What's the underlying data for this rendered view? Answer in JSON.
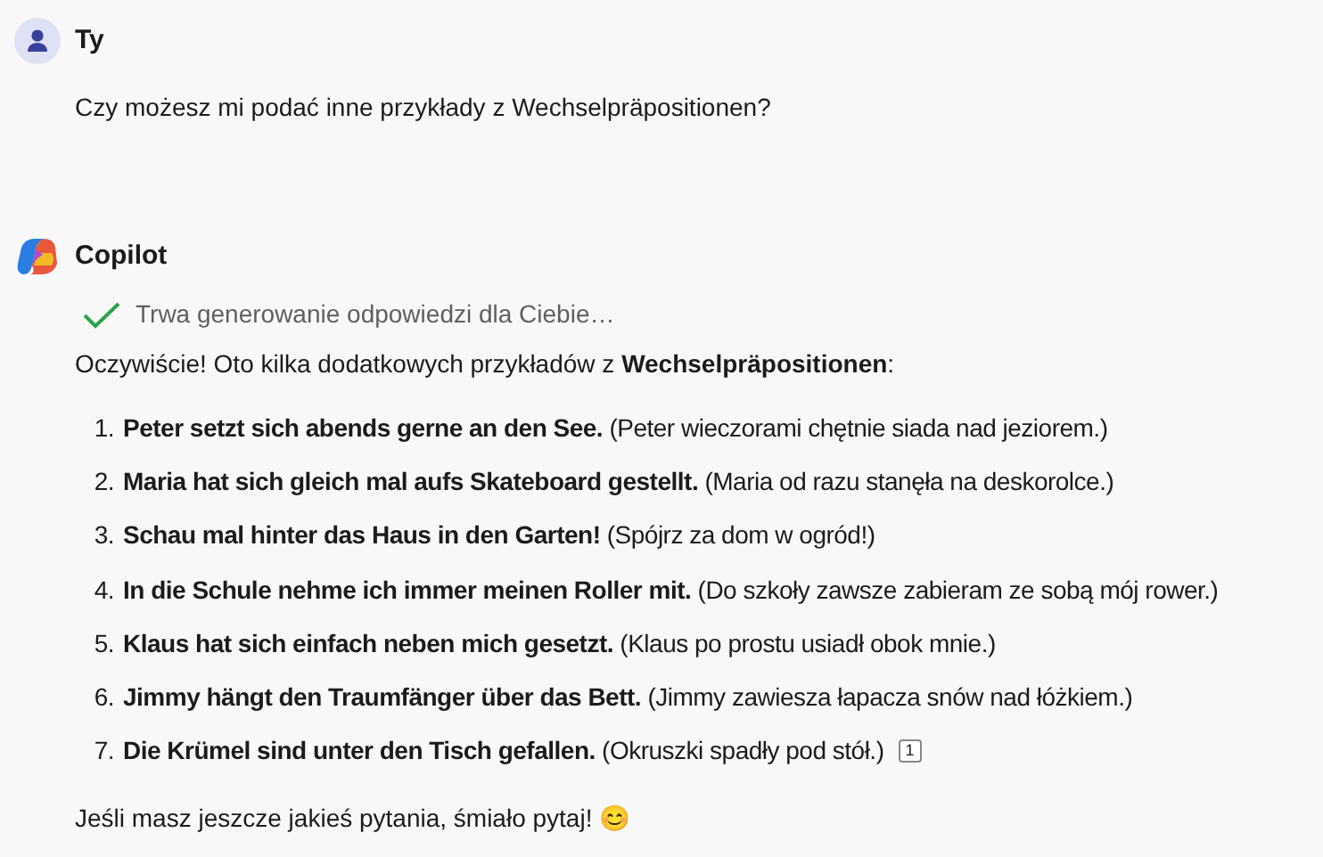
{
  "user_message": {
    "author": "Ty",
    "text": "Czy możesz mi podać inne przykłady z Wechselpräpositionen?"
  },
  "assistant_message": {
    "author": "Copilot",
    "status": "Trwa generowanie odpowiedzi dla Ciebie…",
    "intro": "Oczywiście! Oto kilka dodatkowych przykładów z **Wechselpräpositionen**:",
    "items": [
      {
        "number": "1.",
        "text": "**Peter setzt sich abends gerne an den See.** (Peter wieczorami chętnie siada nad jeziorem.)"
      },
      {
        "number": "2.",
        "text": "**Maria hat sich gleich mal aufs Skateboard gestellt.** (Maria od razu stanęła na deskorolce.)"
      },
      {
        "number": "3.",
        "text": "**Schau mal hinter das Haus in den Garten!** (Spójrz za dom w ogród!)"
      },
      {
        "number": "4.",
        "text": "**In die Schule nehme ich immer meinen Roller mit.** (Do szkoły zawsze zabieram ze sobą mój rower.)"
      },
      {
        "number": "5.",
        "text": "**Klaus hat sich einfach neben mich gesetzt.** (Klaus po prostu usiadł obok mnie.)"
      },
      {
        "number": "6.",
        "text": "**Jimmy hängt den Traumfänger über das Bett.** (Jimmy zawiesza łapacza snów nad łóżkiem.)"
      },
      {
        "number": "7.",
        "text": "**Die Krümel sind unter den Tisch gefallen.** (Okruszki spadły pod stół.)",
        "citation": "1"
      }
    ],
    "closing": "Jeśli masz jeszcze jakieś pytania, śmiało pytaj! 😊"
  }
}
